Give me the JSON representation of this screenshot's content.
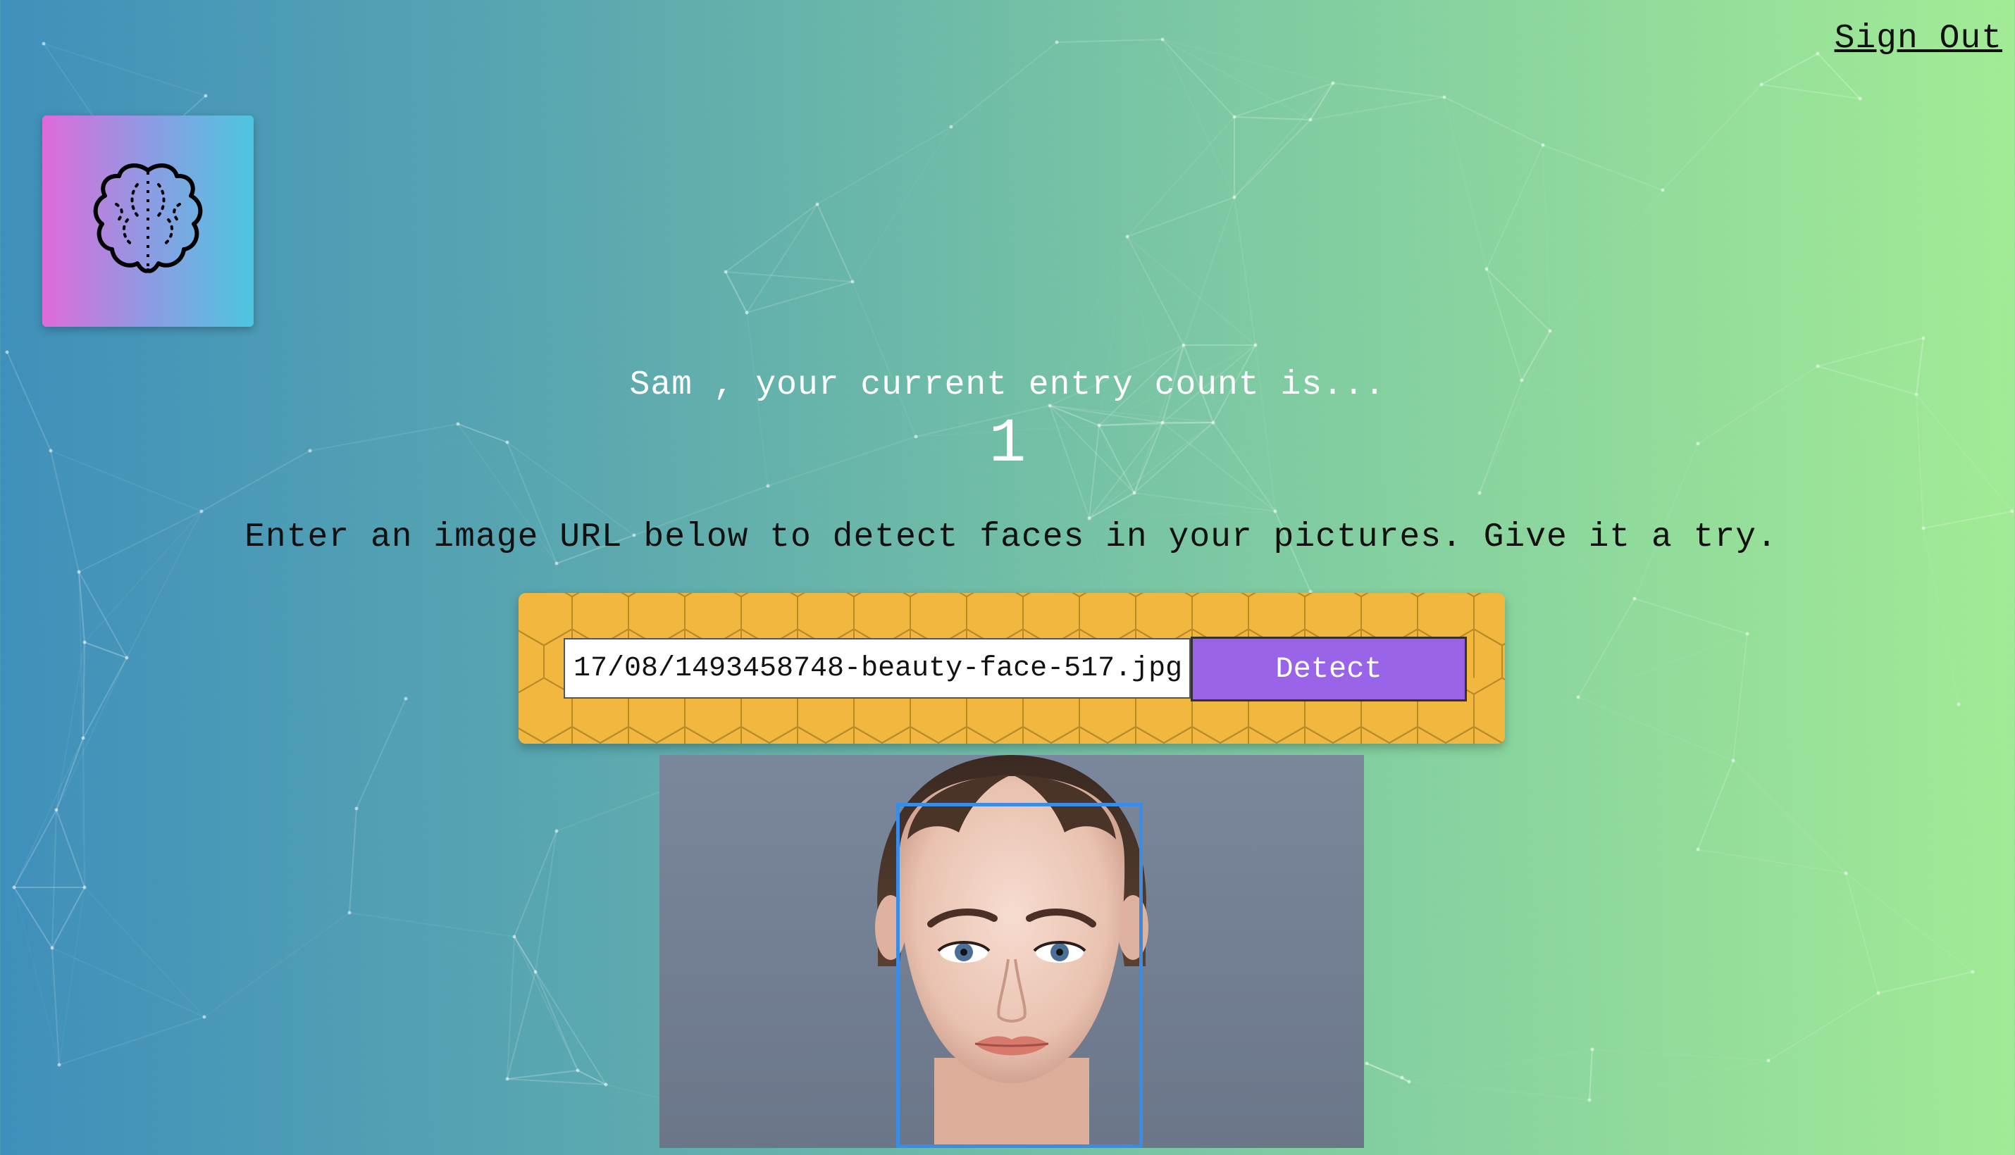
{
  "header": {
    "signout_label": "Sign Out"
  },
  "logo": {
    "icon": "brain-icon",
    "gradient": [
      "#e06ada",
      "#8d9be2",
      "#4dc6e0"
    ]
  },
  "rank": {
    "greeting": "Sam , your current entry count is...",
    "entries": "1"
  },
  "instructions": {
    "text": "Enter an image URL below to detect faces in your pictures. Give it a try."
  },
  "form": {
    "url_value": "17/08/1493458748-beauty-face-517.jpg",
    "detect_label": "Detect",
    "panel_color": "#f2b73e",
    "button_color": "#9a64e8"
  },
  "result": {
    "image_description_icon": "face-photo",
    "box_color": "#3a8de6"
  },
  "colors": {
    "gradient_start": "#3f8fbc",
    "gradient_end": "#a2eb95"
  }
}
